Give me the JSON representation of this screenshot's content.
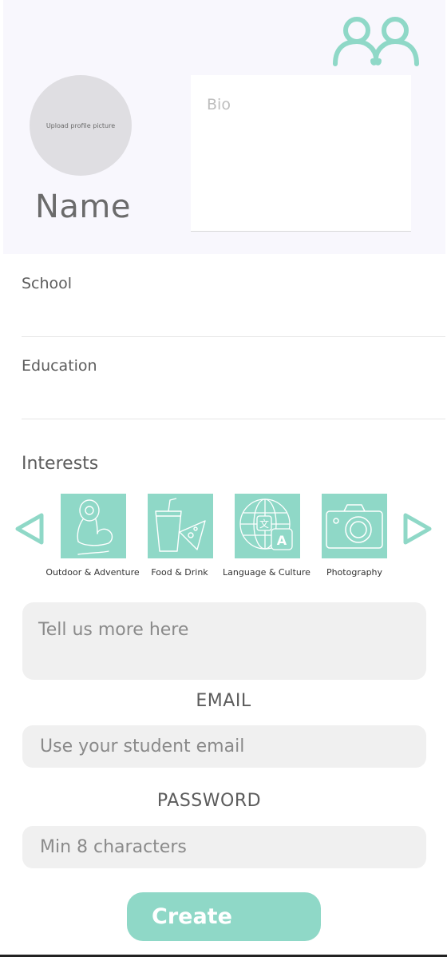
{
  "colors": {
    "accent": "#8fd8c7",
    "panel": "#f8f7fd",
    "field_bg": "#f0f0f0",
    "avatar": "#dfdee2"
  },
  "header": {
    "logo_icon": "two-people-icon",
    "avatar_label": "Upload profile picture",
    "name": "Name",
    "bio_placeholder": "Bio"
  },
  "fields": {
    "school_placeholder": "School",
    "education_placeholder": "Education"
  },
  "interests": {
    "title": "Interests",
    "prev_icon": "triangle-left-icon",
    "next_icon": "triangle-right-icon",
    "items": [
      {
        "label": "Outdoor & Adventure",
        "icon": "flexed-arm-icon"
      },
      {
        "label": "Food & Drink",
        "icon": "cup-and-pizza-icon"
      },
      {
        "label": "Language & Culture",
        "icon": "globe-translate-icon"
      },
      {
        "label": "Photography",
        "icon": "camera-icon"
      }
    ],
    "more_placeholder": "Tell us more here"
  },
  "email": {
    "label": "EMAIL",
    "placeholder": "Use your student email"
  },
  "password": {
    "label": "PASSWORD",
    "placeholder": "Min 8 characters"
  },
  "create_label": "Create"
}
